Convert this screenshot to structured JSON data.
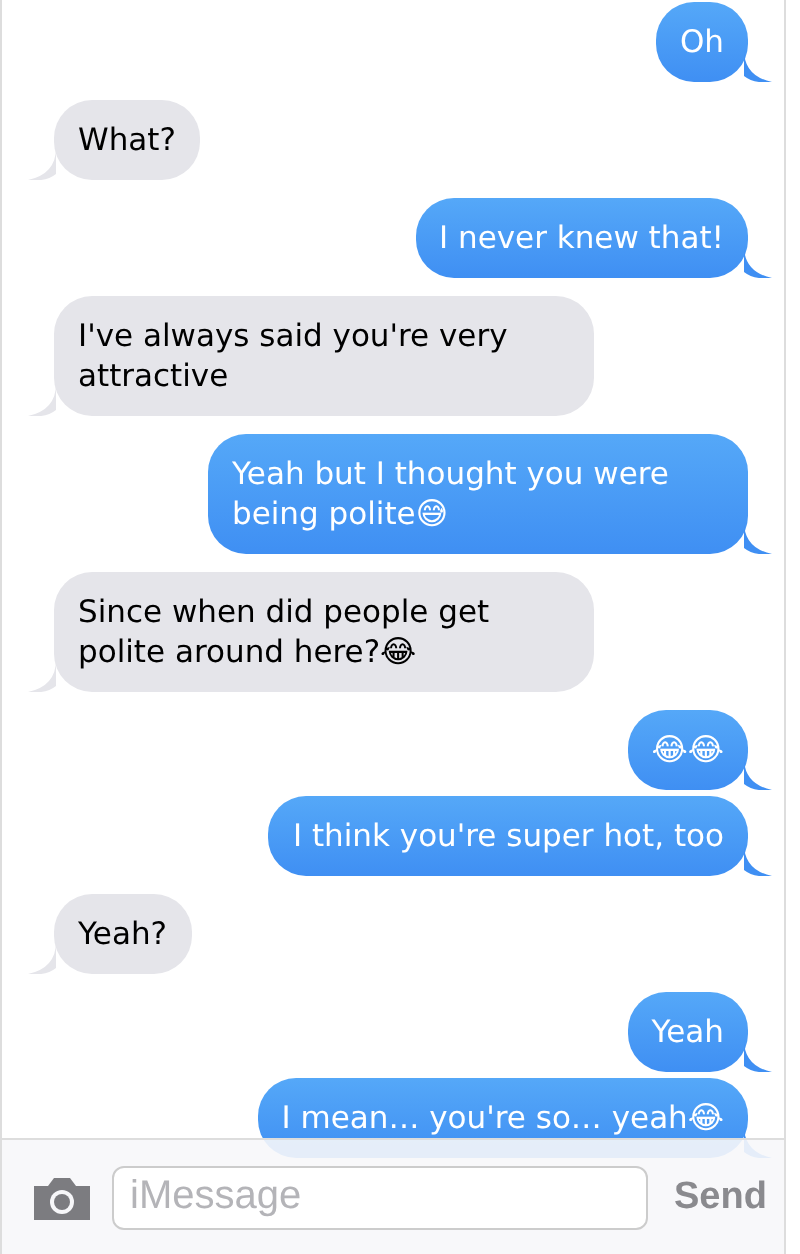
{
  "messages": [
    {
      "kind": "sent",
      "text": "Oh"
    },
    {
      "kind": "received",
      "text": "What?"
    },
    {
      "kind": "sent",
      "text": "I never knew that!"
    },
    {
      "kind": "received",
      "text": "I've always said you're very attractive"
    },
    {
      "kind": "sent",
      "text": "Yeah but I thought you were being polite😅"
    },
    {
      "kind": "received",
      "text": "Since when did people get polite around here?😂"
    },
    {
      "kind": "sent",
      "text": "😂😂"
    },
    {
      "kind": "sent",
      "text": "I think you're super hot, too"
    },
    {
      "kind": "received",
      "text": "Yeah?"
    },
    {
      "kind": "sent",
      "text": "Yeah"
    },
    {
      "kind": "sent",
      "text": "I mean… you're so… yeah😂"
    }
  ],
  "composer": {
    "placeholder": "iMessage",
    "send_label": "Send"
  }
}
